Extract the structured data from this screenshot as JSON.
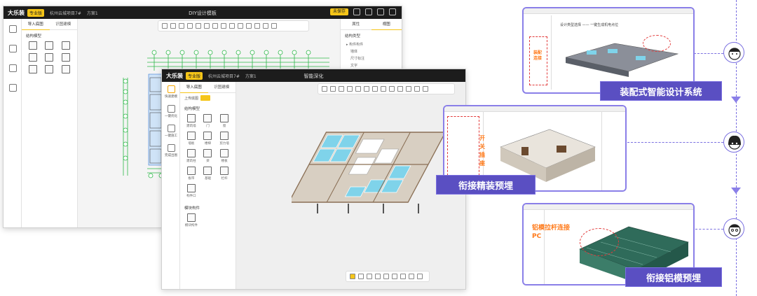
{
  "back_window": {
    "logo": "大乐装",
    "edition": "专业版",
    "breadcrumb": "杭州云城项目7#",
    "plan": "方案1",
    "title": "DIY设计模板",
    "save_label": "未保存",
    "right_tabs": [
      "属性",
      "视图"
    ],
    "tree_title": "结构类型",
    "tree_items": [
      "▸ 构件构件",
      "墙体",
      "尺寸标注",
      "文字"
    ]
  },
  "main_window": {
    "logo": "大乐装",
    "edition": "专业版",
    "breadcrumb": "杭州云城项目7#",
    "plan": "方案1",
    "title": "智能深化",
    "left_nav": [
      "快速建模",
      "一键优化",
      "一键施工",
      "完成出图"
    ],
    "tabs": [
      "导入底图",
      "识图建模"
    ],
    "upload_label": "上传底图",
    "section1": "结构模型",
    "items": [
      "建筑墙",
      "门",
      "窗",
      "墙板",
      "楼梯",
      "剪力墙",
      "建筑柱",
      "梁",
      "楼板",
      "板带",
      "基础",
      "栏杆",
      "构件口"
    ],
    "section2": "模块构件",
    "module_item": "模块构件"
  },
  "shots": {
    "top_caption": "设计类型选择 —— 一键生成机电点位",
    "top_red_label": "装配连接",
    "mid_red_label": "开关插座",
    "bot_red_label": "铝模拉杆连接PC"
  },
  "callouts": {
    "c1": "装配式智能设计系统",
    "c2": "衔接精装预埋",
    "c3": "衔接铝模预埋"
  },
  "colors": {
    "accent": "#5a4fc2",
    "highlight": "#f5c518",
    "red": "#e23b3b"
  }
}
